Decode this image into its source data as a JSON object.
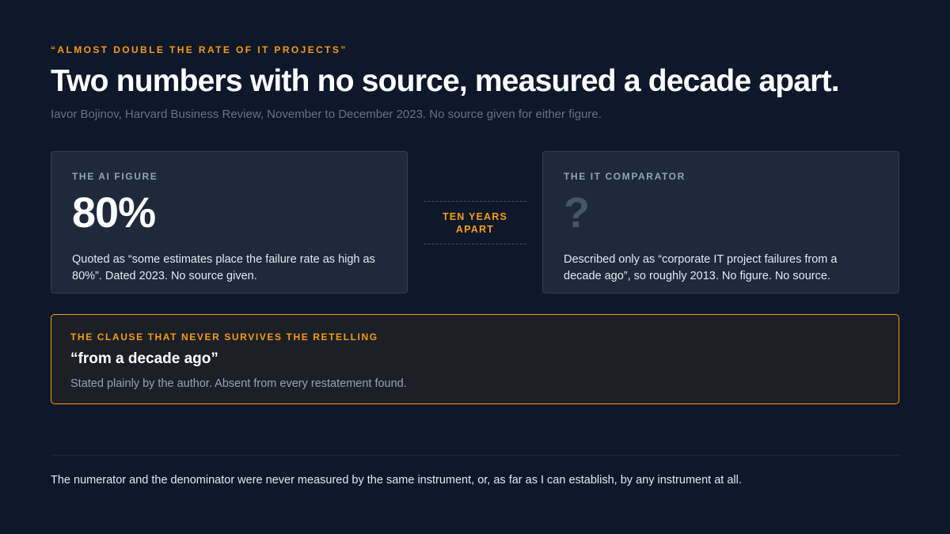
{
  "eyebrow": "“Almost double the rate of IT projects”",
  "title": "Two numbers with no source, measured a decade apart.",
  "subtitle": "Iavor Bojinov, Harvard Business Review, November to December 2023. No source given for either figure.",
  "left_card": {
    "label": "The AI figure",
    "value": "80%",
    "description": "Quoted as “some estimates place the failure rate as high as 80%”. Dated 2023. No source given."
  },
  "gap": {
    "label": "Ten years apart"
  },
  "right_card": {
    "label": "The IT comparator",
    "value": "?",
    "description": "Described only as “corporate IT project failures from a decade ago”, so roughly 2013. No figure. No source."
  },
  "callout": {
    "label": "The clause that never survives the retelling",
    "quote": "“from a decade ago”",
    "body": "Stated plainly by the author. Absent from every restatement found."
  },
  "footer": "The numerator and the denominator were never measured by the same instrument, or, as far as I can establish, by any instrument at all.",
  "colors": {
    "background": "#0f172a",
    "accent": "#f59e0b",
    "card": "#1e293b"
  }
}
